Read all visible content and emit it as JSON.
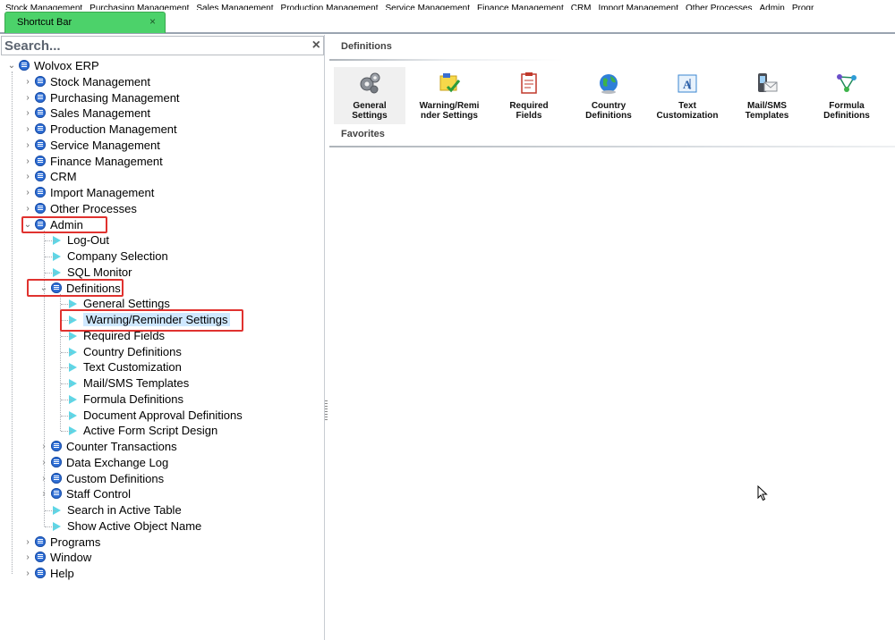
{
  "menubar": {
    "items": [
      "Stock Management",
      "Purchasing Management",
      "Sales Management",
      "Production Management",
      "Service Management",
      "Finance Management",
      "CRM",
      "Import Management",
      "Other Processes",
      "Admin",
      "Progr"
    ]
  },
  "tab": {
    "label": "Shortcut Bar",
    "close": "×"
  },
  "search": {
    "placeholder": "Search...",
    "clear": "×"
  },
  "tree": [
    {
      "label": "Wolvox ERP",
      "expander": "⌄"
    },
    {
      "label": "Stock Management",
      "expander": "›"
    },
    {
      "label": "Purchasing Management",
      "expander": "›"
    },
    {
      "label": "Sales Management",
      "expander": "›"
    },
    {
      "label": "Production Management",
      "expander": "›"
    },
    {
      "label": "Service Management",
      "expander": "›"
    },
    {
      "label": "Finance Management",
      "expander": "›"
    },
    {
      "label": "CRM",
      "expander": "›"
    },
    {
      "label": "Import Management",
      "expander": "›"
    },
    {
      "label": "Other Processes",
      "expander": "›"
    },
    {
      "label": "Admin",
      "expander": "⌄"
    },
    {
      "label": "Log-Out"
    },
    {
      "label": "Company Selection"
    },
    {
      "label": "SQL Monitor"
    },
    {
      "label": "Definitions",
      "expander": "⌄"
    },
    {
      "label": "General Settings"
    },
    {
      "label": "Warning/Reminder Settings"
    },
    {
      "label": "Required Fields"
    },
    {
      "label": "Country Definitions"
    },
    {
      "label": "Text Customization"
    },
    {
      "label": "Mail/SMS Templates"
    },
    {
      "label": "Formula Definitions"
    },
    {
      "label": "Document Approval Definitions"
    },
    {
      "label": "Active Form Script Design"
    },
    {
      "label": "Counter Transactions",
      "expander": "›"
    },
    {
      "label": "Data Exchange Log",
      "expander": "›"
    },
    {
      "label": "Custom Definitions",
      "expander": "›"
    },
    {
      "label": "Staff Control",
      "expander": "›"
    },
    {
      "label": "Search in Active Table"
    },
    {
      "label": "Show Active Object Name"
    },
    {
      "label": "Programs",
      "expander": "›"
    },
    {
      "label": "Window",
      "expander": "›"
    },
    {
      "label": "Help",
      "expander": "›"
    }
  ],
  "right": {
    "definitions_label": "Definitions",
    "favorites_label": "Favorites",
    "buttons": [
      {
        "line1": "General",
        "line2": "Settings",
        "icon": "gears-icon"
      },
      {
        "line1": "Warning/Remi",
        "line2": "nder Settings",
        "icon": "warning-note-icon"
      },
      {
        "line1": "Required",
        "line2": "Fields",
        "icon": "clipboard-icon"
      },
      {
        "line1": "Country",
        "line2": "Definitions",
        "icon": "globe-icon"
      },
      {
        "line1": "Text",
        "line2": "Customization",
        "icon": "text-edit-icon"
      },
      {
        "line1": "Mail/SMS",
        "line2": "Templates",
        "icon": "phone-mail-icon"
      },
      {
        "line1": "Formula",
        "line2": "Definitions",
        "icon": "formula-graph-icon"
      }
    ]
  },
  "colors": {
    "tab_green": "#4cd26a",
    "highlight_red": "#e0322f",
    "node_blue": "#2f6fd6",
    "leaf_cyan": "#5fd6e6",
    "selection": "#cfe8ff"
  }
}
